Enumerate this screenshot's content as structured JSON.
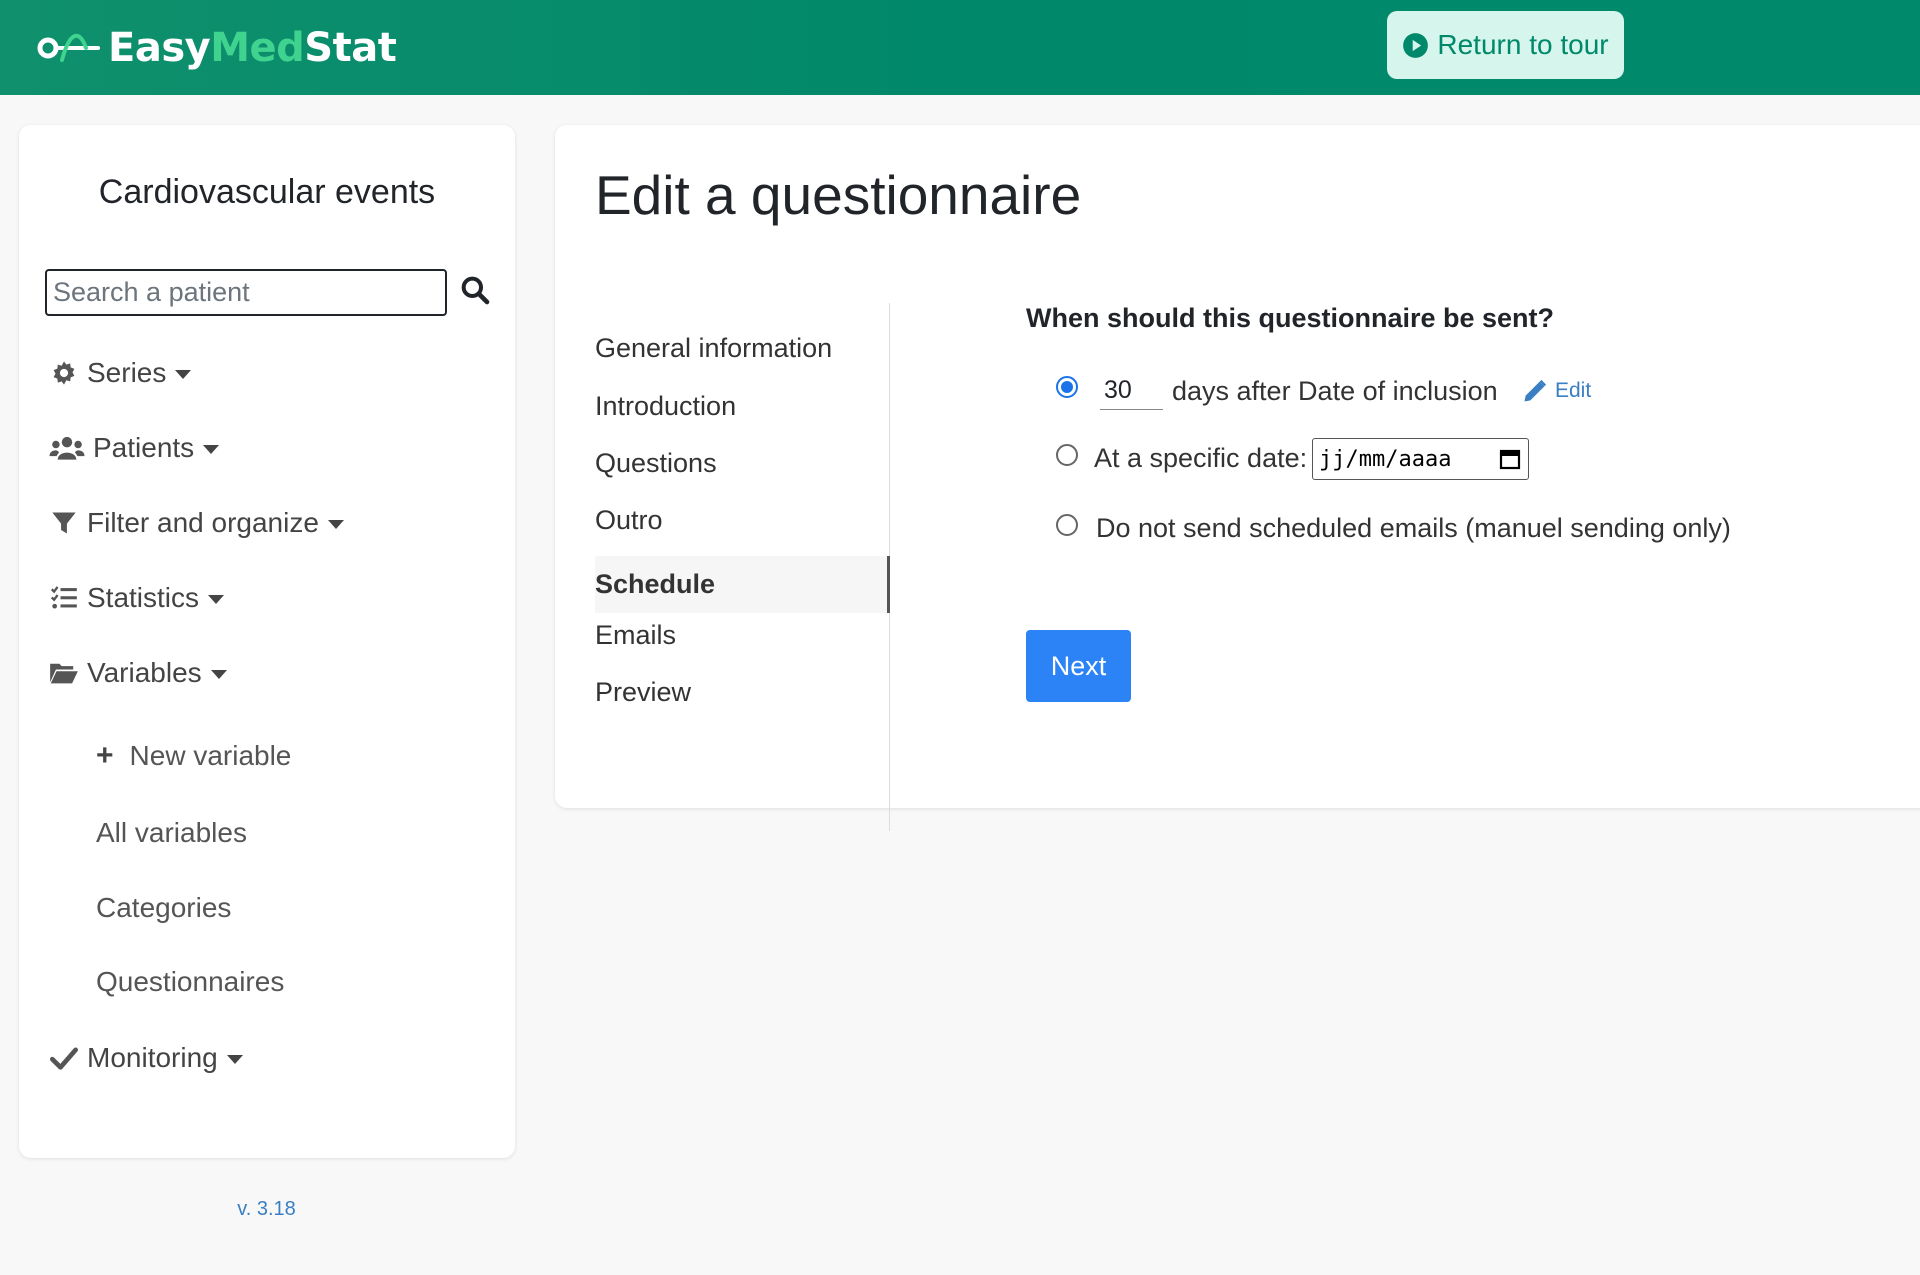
{
  "header": {
    "logo": {
      "part1": "Easy",
      "part2": "Med",
      "part3": "Stat"
    },
    "tour_button": "Return to tour"
  },
  "sidebar": {
    "project_title": "Cardiovascular events",
    "search_placeholder": "Search a patient",
    "nav": [
      {
        "label": "Series",
        "icon": "gear-icon"
      },
      {
        "label": "Patients",
        "icon": "users-icon"
      },
      {
        "label": "Filter and organize",
        "icon": "filter-icon"
      },
      {
        "label": "Statistics",
        "icon": "list-check-icon"
      },
      {
        "label": "Variables",
        "icon": "folder-open-icon"
      },
      {
        "label": "Monitoring",
        "icon": "check-icon"
      }
    ],
    "variables_sub": [
      "New variable",
      "All variables",
      "Categories",
      "Questionnaires"
    ],
    "version": "v. 3.18"
  },
  "main": {
    "title": "Edit a questionnaire",
    "steps": [
      "General information",
      "Introduction",
      "Questions",
      "Outro",
      "Schedule",
      "Emails",
      "Preview"
    ],
    "active_step": "Schedule",
    "question": "When should this questionnaire be sent?",
    "option_days": {
      "value": "30",
      "text": "days after Date of inclusion",
      "edit": "Edit",
      "selected": true
    },
    "option_date": {
      "text": "At a specific date:",
      "placeholder": "jj/mm/aaaa",
      "selected": false
    },
    "option_none": {
      "text": "Do not send scheduled emails (manuel sending only)",
      "selected": false
    },
    "next_button": "Next"
  },
  "colors": {
    "header": "#00886a",
    "accent": "#2b83f6",
    "link": "#3a7fc4",
    "tour_bg": "#d6f5ec"
  }
}
